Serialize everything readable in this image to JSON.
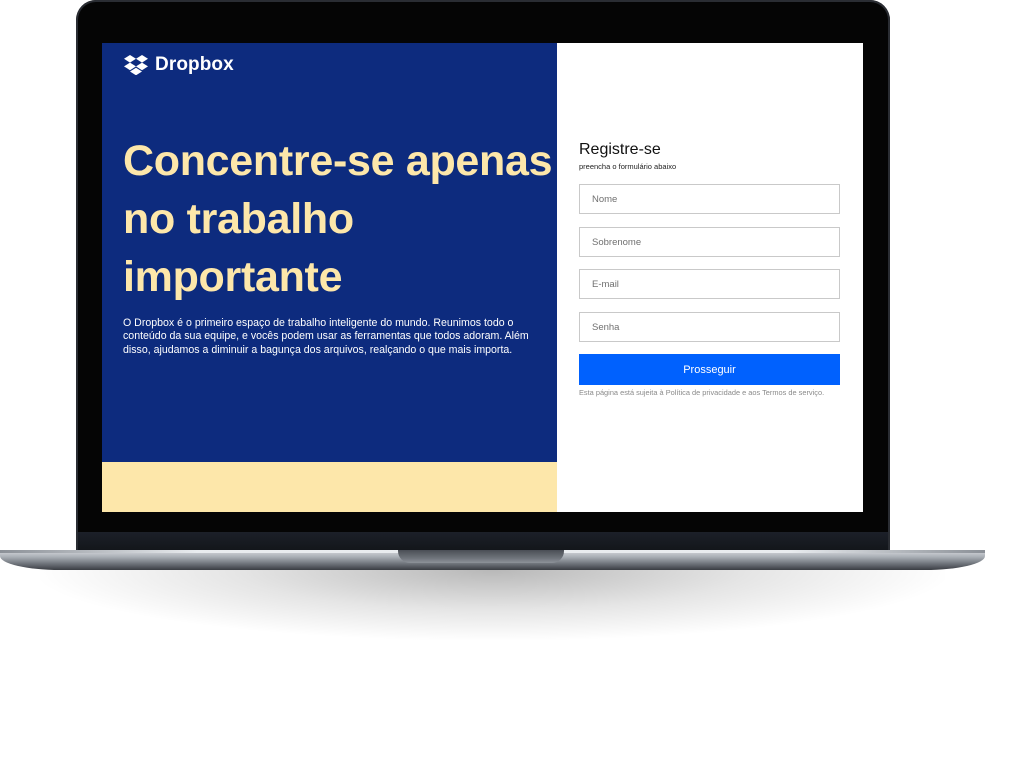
{
  "brand": {
    "name": "Dropbox",
    "logo_icon": "dropbox-box-icon"
  },
  "hero": {
    "headline": "Concentre-se apenas no trabalho importante",
    "description": "O Dropbox é o primeiro espaço de trabalho inteligente do mundo. Reunimos todo o conteúdo da sua equipe, e vocês podem usar as ferramentas que todos adoram. Além disso, ajudamos a diminuir a bagunça dos arquivos, realçando o que mais importa."
  },
  "form": {
    "title": "Registre-se",
    "subtitle": "preencha o formulário abaixo",
    "fields": {
      "name": {
        "placeholder": "Nome",
        "value": ""
      },
      "surname": {
        "placeholder": "Sobrenome",
        "value": ""
      },
      "email": {
        "placeholder": "E-mail",
        "value": ""
      },
      "password": {
        "placeholder": "Senha",
        "value": ""
      }
    },
    "submit_label": "Prosseguir",
    "terms": "Esta página está sujeita à Política de privacidade e aos Termos de serviço."
  },
  "colors": {
    "brand_blue": "#0d2b7e",
    "accent_cream": "#fde7aa",
    "button_blue": "#0061fe"
  }
}
